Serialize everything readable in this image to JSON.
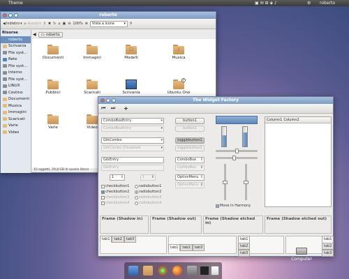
{
  "panel": {
    "title": "Theme",
    "user": "roberto"
  },
  "filemanager": {
    "title": "roberto",
    "toolbar": {
      "back": "Indietro",
      "forward": "Avanti",
      "zoom": "100%",
      "view": "Vista a icone"
    },
    "path": "roberto",
    "sidebar": {
      "header": "Risorse",
      "items": [
        "roberto",
        "Scrivania",
        "File syst...",
        "Rete",
        "File syst...",
        "Interno",
        "File syst...",
        "LINUX",
        "Cestino",
        "Documenti",
        "Musica",
        "Immagini",
        "Scaricati",
        "Varie",
        "Video"
      ]
    },
    "folders": [
      "Documenti",
      "Immagini",
      "Modelli",
      "Musica",
      "Pubblici",
      "Scaricati",
      "Scrivania",
      "Ubuntu One",
      "Varie",
      "Video"
    ],
    "status": "10 oggetti, 29,8 GB di spazio libero"
  },
  "widget_factory": {
    "title": "The Widget Factory",
    "combo_entry": "ComboBoxEntry",
    "combo_entry_dis": "ComboBoxEntry",
    "gtkcombo": "GtkCombo",
    "gtkcombo_dis": "GtkCombo (Disabled)",
    "gtkentry": "GtkEntry",
    "gtkentry_dis": "GtkEntry",
    "spin1": "1",
    "spin2": "1",
    "button1": "button1",
    "button2": "button2",
    "togglebutton1": "togglebutton1",
    "togglebutton2": "togglebutton2",
    "combobox": "ComboBox",
    "combobox_dis": "ComboBox",
    "optionmenu": "OptionMenu",
    "optionmenu_dis": "OptionMenu",
    "checks": [
      "checkbutton1",
      "checkbutton2",
      "checkbutton3",
      "checkbutton4"
    ],
    "radios": [
      "radiobutton1",
      "radiobutton2",
      "radiobutton3",
      "radiobutton4"
    ],
    "columns": [
      "Column1",
      "Column2"
    ],
    "move_harmony": "Move In Harmony",
    "frames": [
      "Frame (Shadow in)",
      "Frame (Shadow out)",
      "Frame (Shadow etched in)",
      "Frame (Shadow etched out)"
    ],
    "tabs": [
      "tab1",
      "tab2",
      "tab3"
    ]
  },
  "desktop": {
    "computer": "Computer"
  }
}
